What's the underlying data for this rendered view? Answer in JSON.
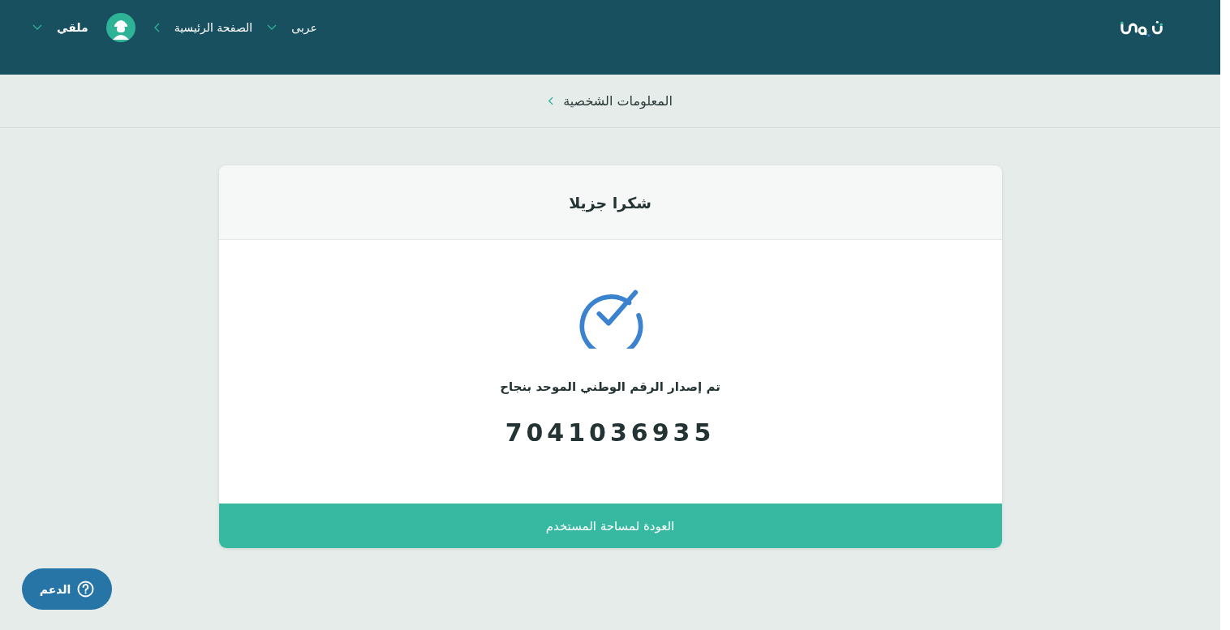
{
  "header": {
    "language": "عربى",
    "home_link": "الصفحة الرئيسية",
    "user": {
      "name": "ملقي"
    }
  },
  "breadcrumb": {
    "label": "المعلومات الشخصية"
  },
  "card": {
    "title": "شكرا جزيلا",
    "message": "تم إصدار الرقم الوطني الموحد بنجاح",
    "number": "7041036935",
    "button": "العودة لمساحة المستخدم"
  },
  "support": {
    "label": "الدعم"
  }
}
